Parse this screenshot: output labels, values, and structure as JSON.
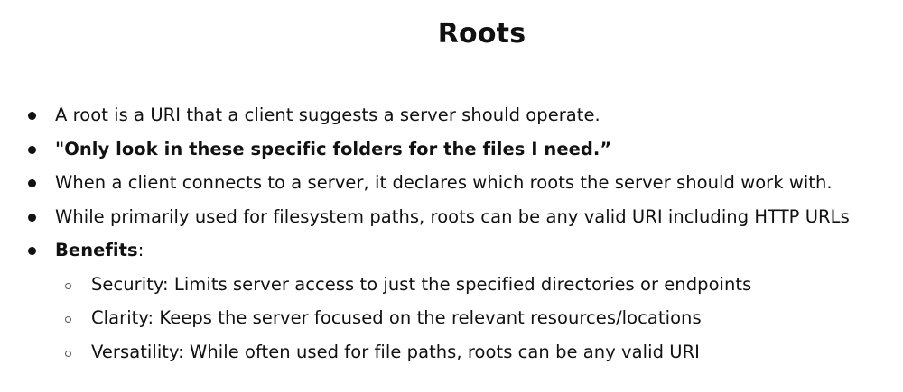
{
  "title": "Roots",
  "bullets": [
    "A root is a URI that a client suggests a server should operate.",
    "\"Only look in these specific folders for the files I need.”",
    "When a client connects to a server, it declares which roots the server should work with.",
    "While primarily used for filesystem paths, roots can be any valid URI including HTTP URLs"
  ],
  "benefits": {
    "label": "Benefits",
    "suffix": ":",
    "items": [
      "Security: Limits server access to just the specified directories or endpoints",
      "Clarity: Keeps the server focused on the relevant resources/locations",
      "Versatility: While often used for file paths, roots can be any valid URI"
    ]
  }
}
